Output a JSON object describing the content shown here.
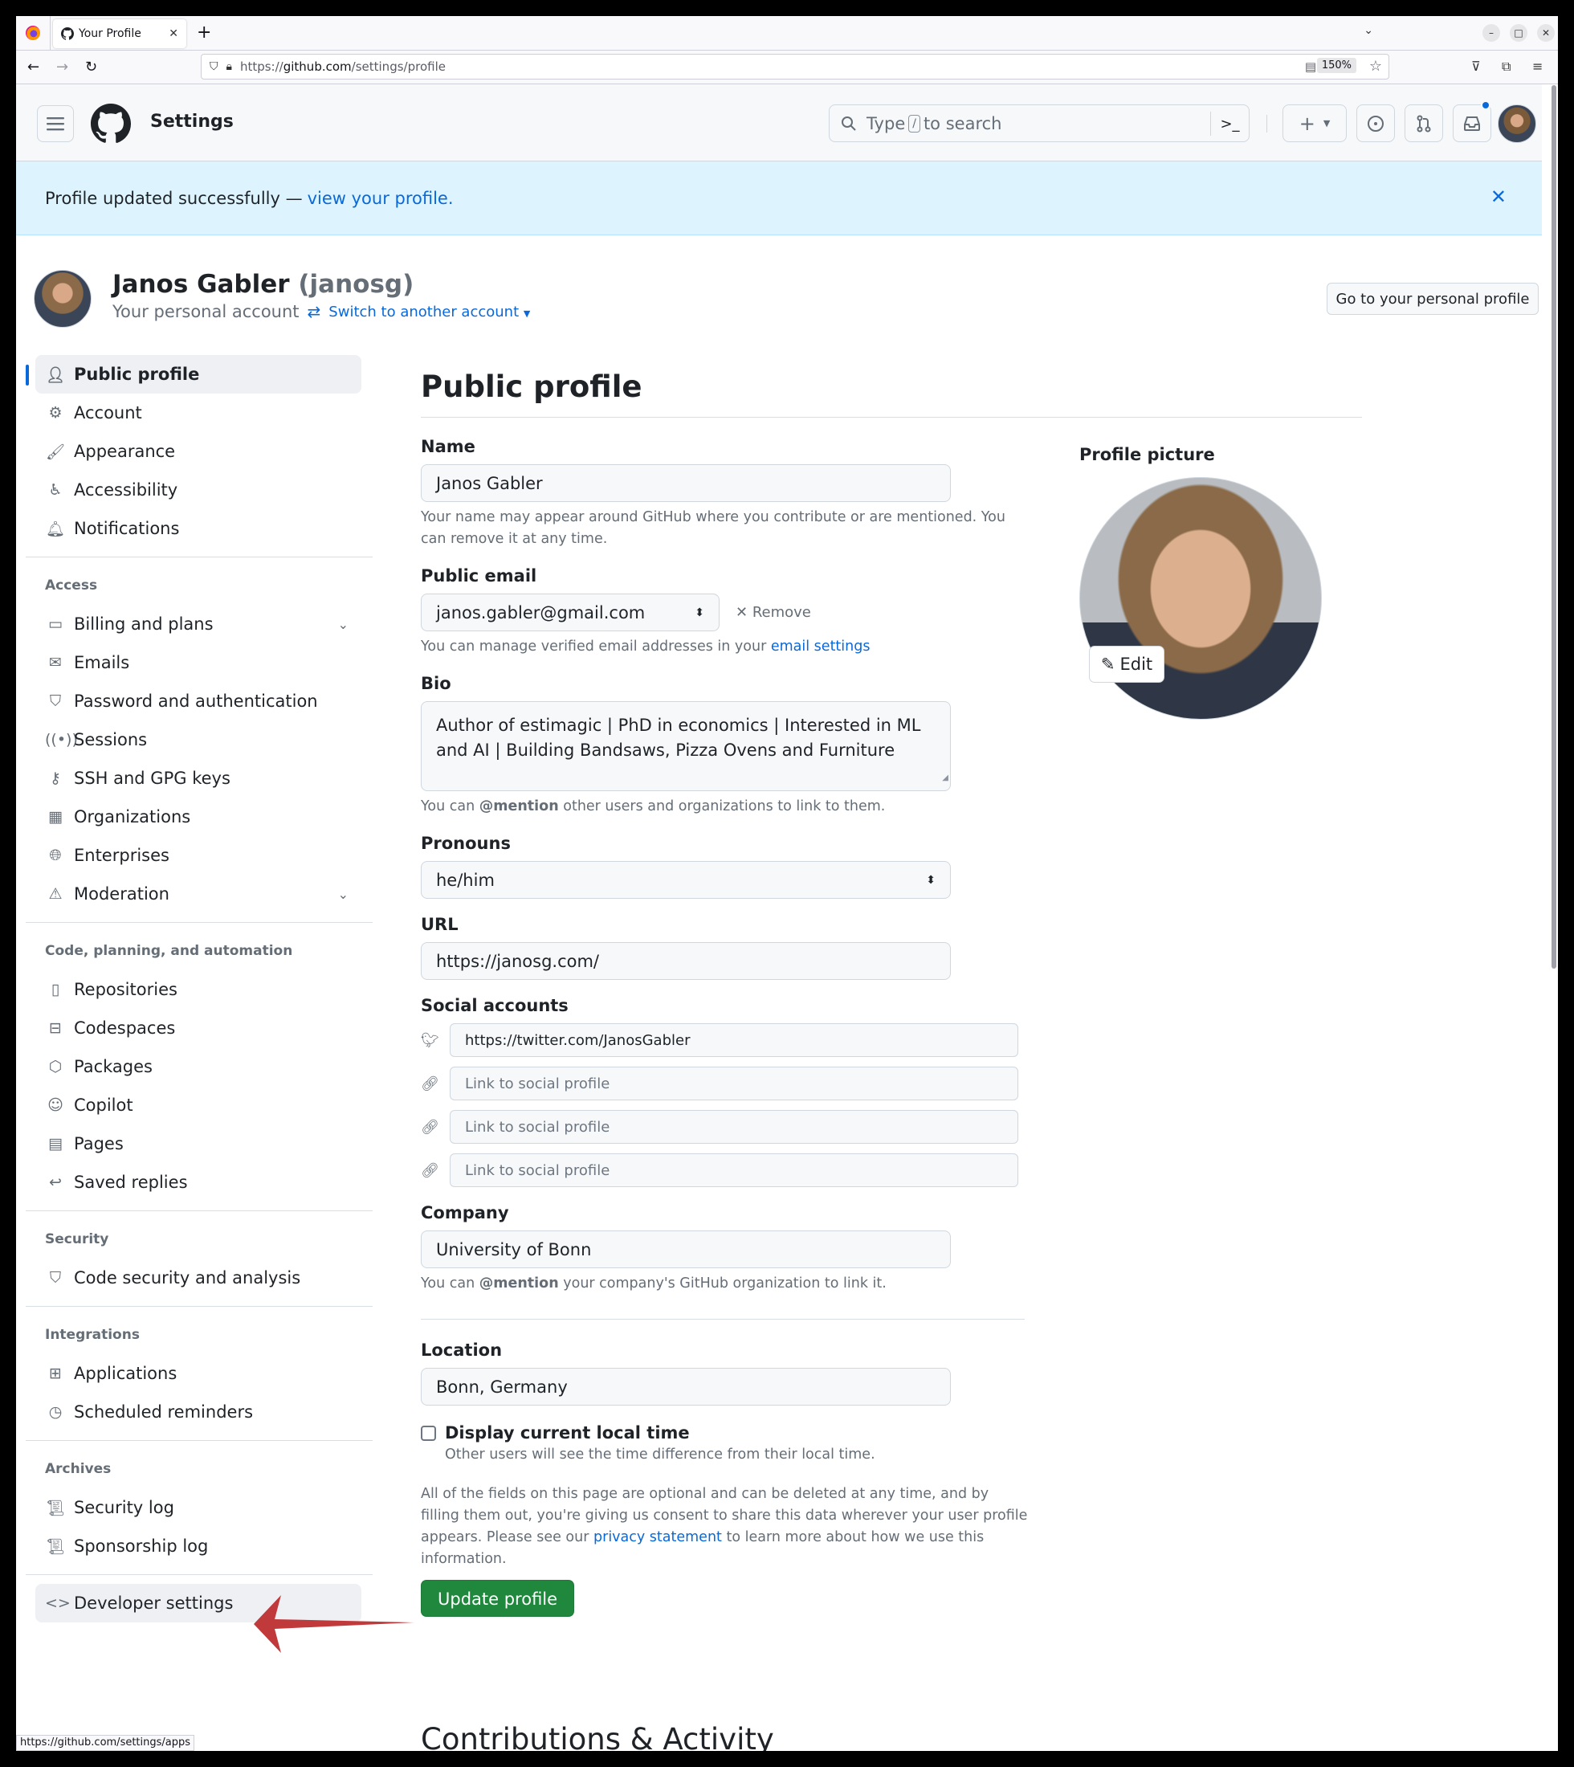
{
  "browser": {
    "tab_title": "Your Profile",
    "url_scheme": "https://",
    "url_host": "github.com",
    "url_path": "/settings/profile",
    "zoom": "150%",
    "status_url": "https://github.com/settings/apps"
  },
  "header": {
    "title": "Settings",
    "search_prefix": "Type",
    "search_key": "/",
    "search_suffix": "to search"
  },
  "banner": {
    "text": "Profile updated successfully —",
    "link": "view your profile."
  },
  "account": {
    "name": "Janos Gabler",
    "login": "(janosg)",
    "subtitle": "Your personal account",
    "switch_label": "Switch to another account",
    "go_profile_label": "Go to your personal profile"
  },
  "sidebar": {
    "top_items": [
      {
        "label": "Public profile",
        "icon": "person-icon",
        "active": true
      },
      {
        "label": "Account",
        "icon": "gear-icon"
      },
      {
        "label": "Appearance",
        "icon": "paintbrush-icon"
      },
      {
        "label": "Accessibility",
        "icon": "accessibility-icon"
      },
      {
        "label": "Notifications",
        "icon": "bell-icon"
      }
    ],
    "access_heading": "Access",
    "access_items": [
      {
        "label": "Billing and plans",
        "icon": "credit-card-icon",
        "expandable": true
      },
      {
        "label": "Emails",
        "icon": "mail-icon"
      },
      {
        "label": "Password and authentication",
        "icon": "shield-lock-icon"
      },
      {
        "label": "Sessions",
        "icon": "broadcast-icon"
      },
      {
        "label": "SSH and GPG keys",
        "icon": "key-icon"
      },
      {
        "label": "Organizations",
        "icon": "organization-icon"
      },
      {
        "label": "Enterprises",
        "icon": "globe-icon"
      },
      {
        "label": "Moderation",
        "icon": "report-icon",
        "expandable": true
      }
    ],
    "code_heading": "Code, planning, and automation",
    "code_items": [
      {
        "label": "Repositories",
        "icon": "repo-icon"
      },
      {
        "label": "Codespaces",
        "icon": "codespaces-icon"
      },
      {
        "label": "Packages",
        "icon": "package-icon"
      },
      {
        "label": "Copilot",
        "icon": "copilot-icon"
      },
      {
        "label": "Pages",
        "icon": "browser-icon"
      },
      {
        "label": "Saved replies",
        "icon": "reply-icon"
      }
    ],
    "security_heading": "Security",
    "security_items": [
      {
        "label": "Code security and analysis",
        "icon": "shield-lock-icon"
      }
    ],
    "integrations_heading": "Integrations",
    "integrations_items": [
      {
        "label": "Applications",
        "icon": "apps-icon"
      },
      {
        "label": "Scheduled reminders",
        "icon": "clock-icon"
      }
    ],
    "archives_heading": "Archives",
    "archives_items": [
      {
        "label": "Security log",
        "icon": "log-icon"
      },
      {
        "label": "Sponsorship log",
        "icon": "log-icon"
      }
    ],
    "developer_settings": "Developer settings"
  },
  "main": {
    "title": "Public profile",
    "name_label": "Name",
    "name_value": "Janos Gabler",
    "name_note": "Your name may appear around GitHub where you contribute or are mentioned. You can remove it at any time.",
    "email_label": "Public email",
    "email_value": "janos.gabler@gmail.com",
    "remove_label": "Remove",
    "email_note_prefix": "You can manage verified email addresses in your",
    "email_note_link": "email settings",
    "bio_label": "Bio",
    "bio_value": "Author of estimagic | PhD in economics | Interested in ML and AI | Building Bandsaws, Pizza Ovens and Furniture",
    "bio_note_prefix": "You can",
    "bio_note_mention": "@mention",
    "bio_note_suffix": "other users and organizations to link to them.",
    "pronouns_label": "Pronouns",
    "pronouns_value": "he/him",
    "url_label": "URL",
    "url_value": "https://janosg.com/",
    "social_label": "Social accounts",
    "social": [
      {
        "icon": "twitter-icon",
        "value": "https://twitter.com/JanosGabler",
        "placeholder": "Link to social profile"
      },
      {
        "icon": "link-icon",
        "value": "",
        "placeholder": "Link to social profile"
      },
      {
        "icon": "link-icon",
        "value": "",
        "placeholder": "Link to social profile"
      },
      {
        "icon": "link-icon",
        "value": "",
        "placeholder": "Link to social profile"
      }
    ],
    "company_label": "Company",
    "company_value": "University of Bonn",
    "company_note_prefix": "You can",
    "company_note_mention": "@mention",
    "company_note_suffix": "your company's GitHub organization to link it.",
    "location_label": "Location",
    "location_value": "Bonn, Germany",
    "local_time_label": "Display current local time",
    "local_time_checked": false,
    "local_time_note": "Other users will see the time difference from their local time.",
    "consent_prefix": "All of the fields on this page are optional and can be deleted at any time, and by filling them out, you're giving us consent to share this data wherever your user profile appears. Please see our",
    "consent_link": "privacy statement",
    "consent_suffix": "to learn more about how we use this information.",
    "update_button": "Update profile",
    "contributions_title": "Contributions & Activity",
    "profile_picture_label": "Profile picture",
    "edit_label": "Edit"
  },
  "colors": {
    "accent": "#0969da",
    "primary_button": "#1f883d",
    "banner_bg": "#ddf4ff",
    "annotation_arrow": "#c0393b"
  }
}
